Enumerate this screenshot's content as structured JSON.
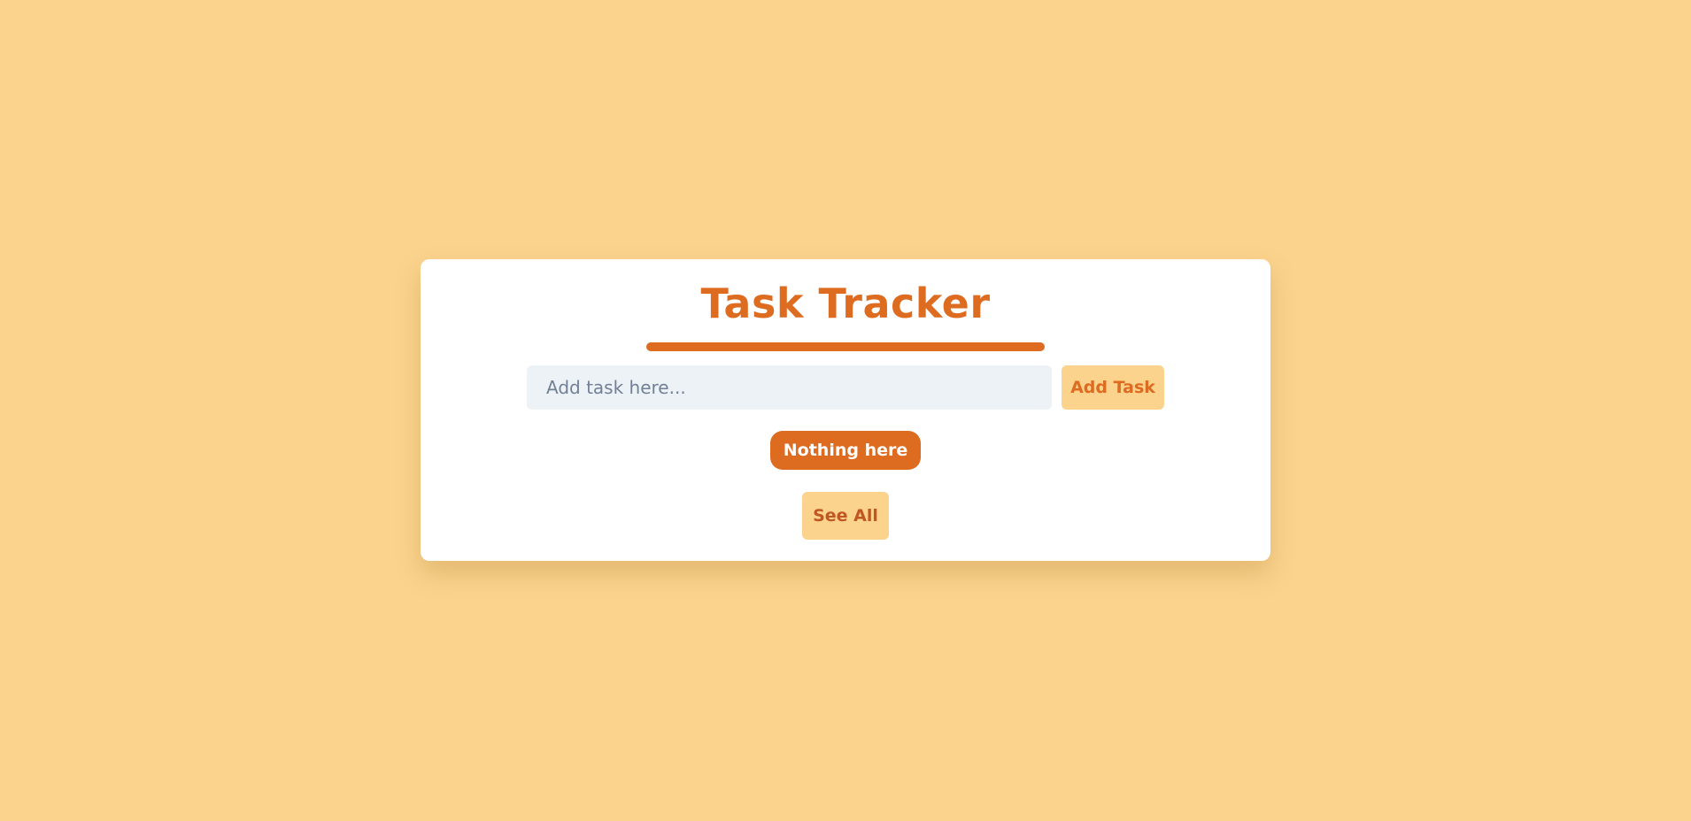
{
  "header": {
    "title": "Task Tracker"
  },
  "task_form": {
    "placeholder": "Add task here...",
    "value": "",
    "add_label": "Add Task"
  },
  "task_list": {
    "empty_message": "Nothing here"
  },
  "footer": {
    "see_all_label": "See All"
  },
  "colors": {
    "background": "#FBD38D",
    "accent": "#DD6B20",
    "see_all_text": "#C05621",
    "input_background": "#EDF2F7"
  }
}
